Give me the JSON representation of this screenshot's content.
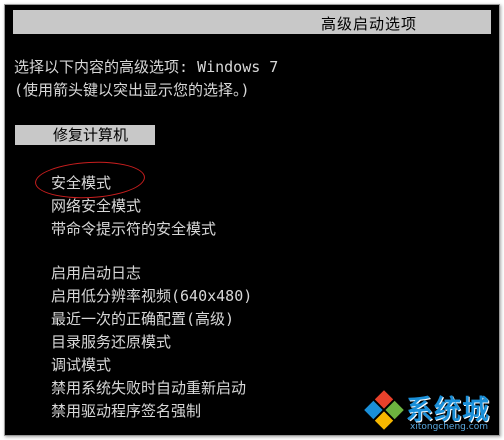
{
  "header": {
    "title": "高级启动选项"
  },
  "prompt": {
    "line1": "选择以下内容的高级选项: Windows 7",
    "line2": "(使用箭头键以突出显示您的选择。)"
  },
  "selected_item": {
    "label": "修复计算机"
  },
  "menu": {
    "items": [
      {
        "label": "安全模式"
      },
      {
        "label": "网络安全模式"
      },
      {
        "label": "带命令提示符的安全模式"
      },
      {
        "label": "启用启动日志"
      },
      {
        "label": "启用低分辨率视频(640x480)"
      },
      {
        "label": "最近一次的正确配置(高级)"
      },
      {
        "label": "目录服务还原模式"
      },
      {
        "label": "调试模式"
      },
      {
        "label": "禁用系统失败时自动重新启动"
      },
      {
        "label": "禁用驱动程序签名强制"
      }
    ]
  },
  "annotation": {
    "circle_color": "#c81e1e"
  },
  "watermark": {
    "brand": "系统城",
    "url": "xitongcheng.com",
    "icon": "windows-logo-icon",
    "brand_color": "#1a8fd8"
  },
  "colors": {
    "background": "#000000",
    "text": "#d8d8d8",
    "highlight": "#c8c8c8"
  }
}
